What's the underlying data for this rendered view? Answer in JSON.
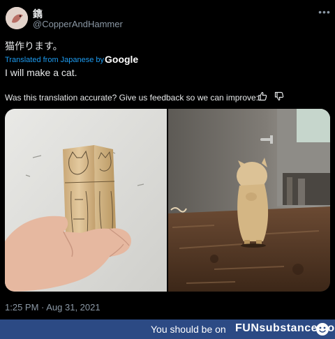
{
  "tweet": {
    "display_name": "鐫",
    "handle": "@CopperAndHammer",
    "more_icon": "more-horizontal-icon",
    "text_original": "猫作ります。",
    "translated_label": "Translated from Japanese by",
    "translator": "Google",
    "text_translated": "I will make a cat.",
    "feedback_prompt": "Was this translation accurate? Give us feedback so we can improve:",
    "thumbs_up_icon": "thumbs-up-icon",
    "thumbs_down_icon": "thumbs-down-icon",
    "timestamp": "1:25 PM · Aug 31, 2021"
  },
  "banner": {
    "text": "You should be on",
    "brand": "FUNsubstance.com",
    "logo_icon": "funsubstance-logo-icon",
    "color": "#2c4a84"
  }
}
